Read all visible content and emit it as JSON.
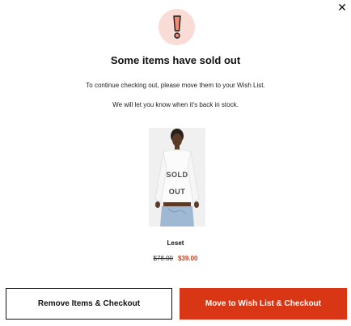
{
  "dialog": {
    "close_glyph": "✕",
    "title": "Some items have sold out",
    "message_line1": "To continue checking out, please move them to your Wish List.",
    "message_line2": "We will let you know when it's back in stock.",
    "alert_icon": "exclamation-icon",
    "alert_colors": {
      "circle": "#f9dcd6",
      "mark_fill": "#f08a75",
      "mark_stroke": "#1a1a1a"
    }
  },
  "product": {
    "badge_line1": "SOLD",
    "badge_line2": "OUT",
    "name": "Leset",
    "original_price": "$78.00",
    "sale_price": "$39.00"
  },
  "actions": {
    "remove_label": "Remove Items & Checkout",
    "move_label": "Move to Wish List & Checkout",
    "primary_color": "#d83614",
    "sale_color": "#d03a17"
  }
}
